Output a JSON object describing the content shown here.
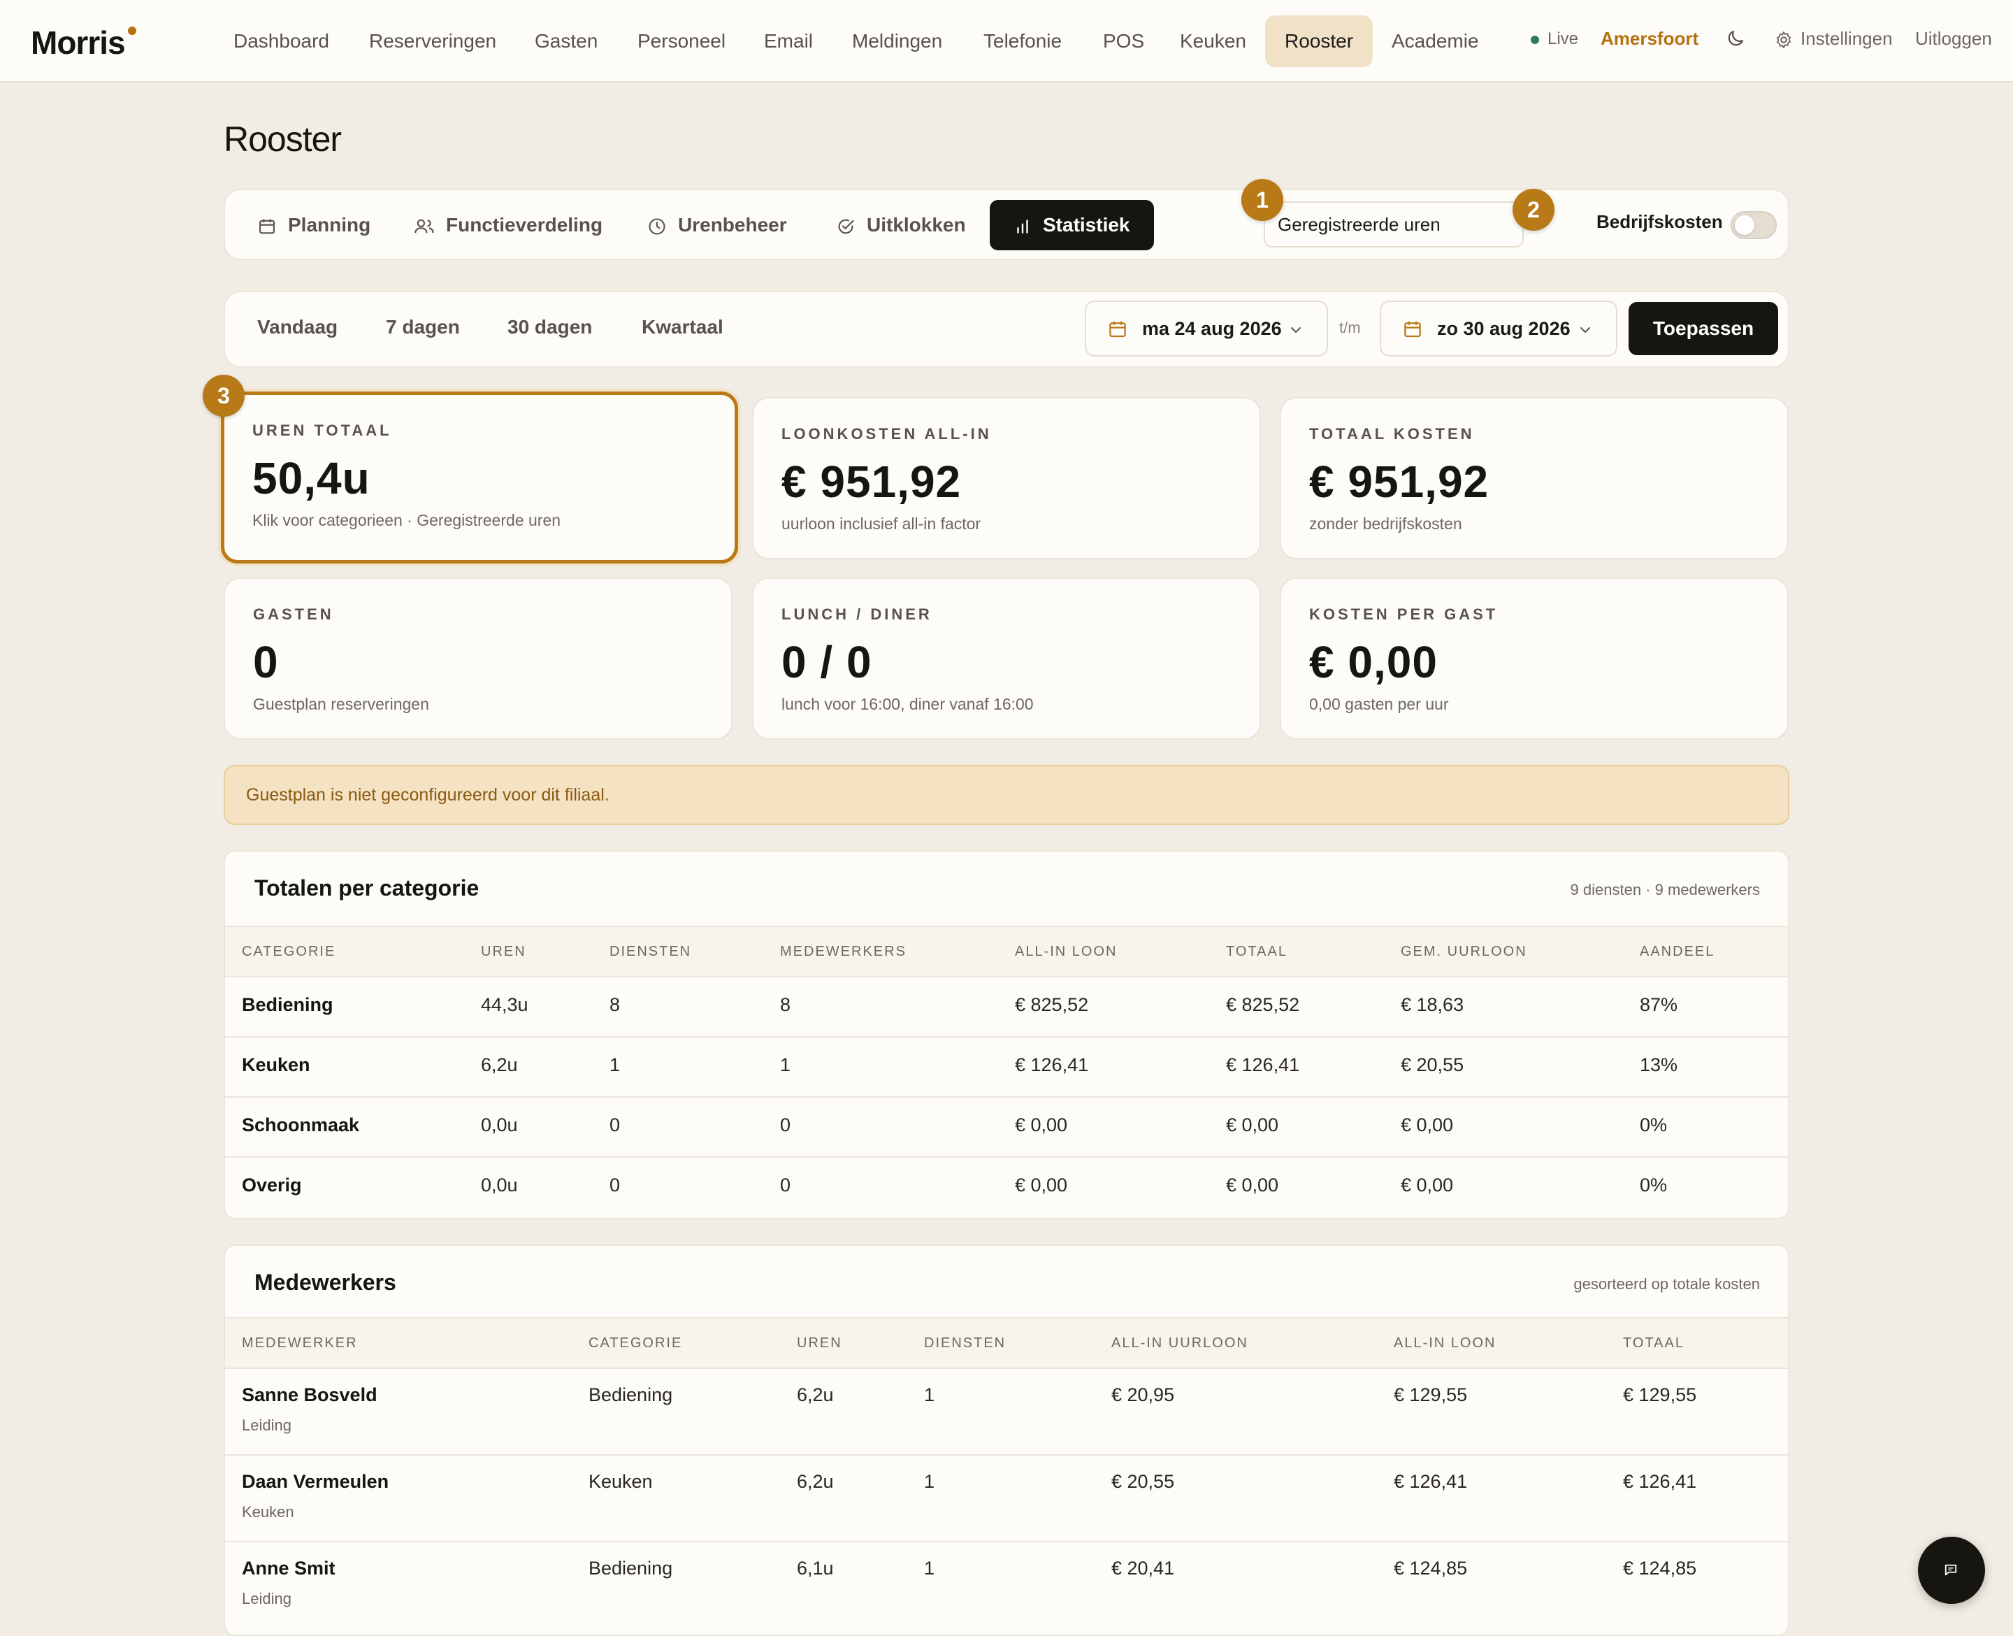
{
  "nav": {
    "logo": "Morris",
    "items": [
      "Dashboard",
      "Reserveringen",
      "Gasten",
      "Personeel",
      "Email",
      "Meldingen",
      "Telefonie",
      "POS",
      "Keuken",
      "Rooster",
      "Academie"
    ],
    "active": "Rooster",
    "live": "Live",
    "branch": "Amersfoort",
    "settings": "Instellingen",
    "logout": "Uitloggen"
  },
  "page": {
    "title": "Rooster"
  },
  "tabs": {
    "items": [
      "Planning",
      "Functieverdeling",
      "Urenbeheer",
      "Uitklokken",
      "Statistiek"
    ],
    "active": "Statistiek",
    "hours_select": "Geregistreerde uren",
    "company_costs_label": "Bedrijfskosten",
    "company_costs_on": false
  },
  "badges": {
    "b1": "1",
    "b2": "2",
    "b3": "3"
  },
  "range": {
    "quick": [
      "Vandaag",
      "7 dagen",
      "30 dagen",
      "Kwartaal"
    ],
    "from": "ma 24 aug 2026",
    "separator": "t/m",
    "to": "zo 30 aug 2026",
    "apply": "Toepassen"
  },
  "stats": [
    {
      "label": "UREN TOTAAL",
      "value": "50,4u",
      "sub": "Klik voor categorieen · Geregistreerde uren"
    },
    {
      "label": "LOONKOSTEN ALL-IN",
      "value": "€ 951,92",
      "sub": "uurloon inclusief all-in factor"
    },
    {
      "label": "TOTAAL KOSTEN",
      "value": "€ 951,92",
      "sub": "zonder bedrijfskosten"
    },
    {
      "label": "GASTEN",
      "value": "0",
      "sub": "Guestplan reserveringen"
    },
    {
      "label": "LUNCH / DINER",
      "value": "0 / 0",
      "sub": "lunch voor 16:00, diner vanaf 16:00"
    },
    {
      "label": "KOSTEN PER GAST",
      "value": "€ 0,00",
      "sub": "0,00 gasten per uur"
    }
  ],
  "notice": "Guestplan is niet geconfigureerd voor dit filiaal.",
  "categories": {
    "title": "Totalen per categorie",
    "meta": "9 diensten · 9 medewerkers",
    "headers": [
      "CATEGORIE",
      "UREN",
      "DIENSTEN",
      "MEDEWERKERS",
      "ALL-IN LOON",
      "TOTAAL",
      "GEM. UURLOON",
      "AANDEEL"
    ],
    "rows": [
      [
        "Bediening",
        "44,3u",
        "8",
        "8",
        "€ 825,52",
        "€ 825,52",
        "€ 18,63",
        "87%"
      ],
      [
        "Keuken",
        "6,2u",
        "1",
        "1",
        "€ 126,41",
        "€ 126,41",
        "€ 20,55",
        "13%"
      ],
      [
        "Schoonmaak",
        "0,0u",
        "0",
        "0",
        "€ 0,00",
        "€ 0,00",
        "€ 0,00",
        "0%"
      ],
      [
        "Overig",
        "0,0u",
        "0",
        "0",
        "€ 0,00",
        "€ 0,00",
        "€ 0,00",
        "0%"
      ]
    ]
  },
  "employees": {
    "title": "Medewerkers",
    "meta": "gesorteerd op totale kosten",
    "headers": [
      "MEDEWERKER",
      "CATEGORIE",
      "UREN",
      "DIENSTEN",
      "ALL-IN UURLOON",
      "ALL-IN LOON",
      "TOTAAL"
    ],
    "rows": [
      {
        "name": "Sanne Bosveld",
        "role": "Leiding",
        "category": "Bediening",
        "hours": "6,2u",
        "shifts": "1",
        "rate": "€ 20,95",
        "wage": "€ 129,55",
        "total": "€ 129,55"
      },
      {
        "name": "Daan Vermeulen",
        "role": "Keuken",
        "category": "Keuken",
        "hours": "6,2u",
        "shifts": "1",
        "rate": "€ 20,55",
        "wage": "€ 126,41",
        "total": "€ 126,41"
      },
      {
        "name": "Anne Smit",
        "role": "Leiding",
        "category": "Bediening",
        "hours": "6,1u",
        "shifts": "1",
        "rate": "€ 20,41",
        "wage": "€ 124,85",
        "total": "€ 124,85"
      }
    ]
  },
  "colors": {
    "accent": "#b87a16",
    "dark": "#17150f",
    "background": "#f1ede5",
    "notice": "#f4e2c3"
  }
}
